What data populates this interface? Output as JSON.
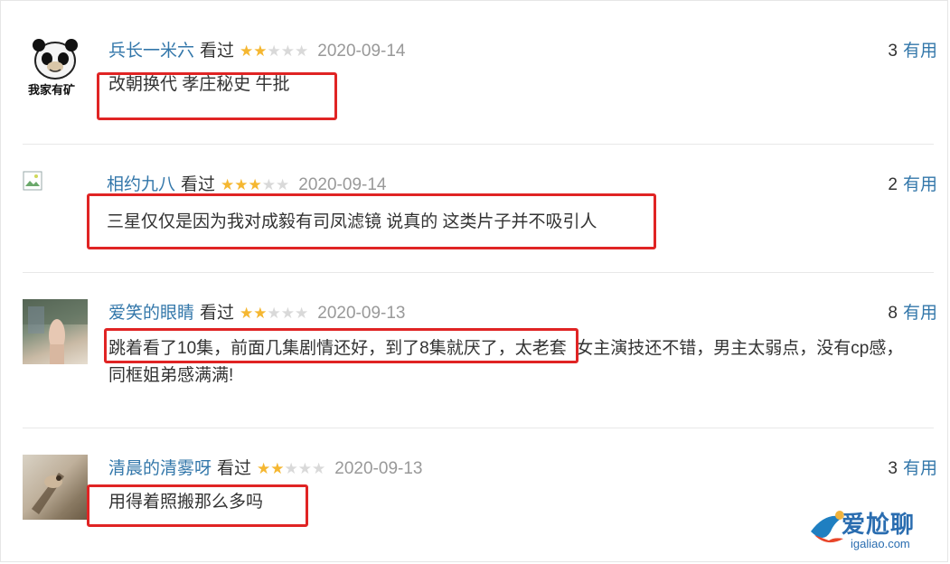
{
  "reviews": [
    {
      "user": "兵长一米六",
      "watched": "看过",
      "rating": 2,
      "date": "2020-09-14",
      "useful_count": "3",
      "useful_label": "有用",
      "comment": "改朝换代 孝庄秘史 牛批",
      "avatar_text": "我家有矿"
    },
    {
      "user": "相约九八",
      "watched": "看过",
      "rating": 3,
      "date": "2020-09-14",
      "useful_count": "2",
      "useful_label": "有用",
      "comment": "三星仅仅是因为我对成毅有司凤滤镜 说真的 这类片子并不吸引人"
    },
    {
      "user": "爱笑的眼睛",
      "watched": "看过",
      "rating": 2,
      "date": "2020-09-13",
      "useful_count": "8",
      "useful_label": "有用",
      "comment_line1": "跳着看了10集，前面几集剧情还好，到了8集就厌了，太老套  女主演技还不错，男主太弱点，没有cp感，",
      "comment_line2": "同框姐弟感满满!"
    },
    {
      "user": "清晨的清雾呀",
      "watched": "看过",
      "rating": 2,
      "date": "2020-09-13",
      "useful_count": "3",
      "useful_label": "有用",
      "comment": "用得着照搬那么多吗"
    }
  ],
  "watermark": {
    "text": "爱尬聊",
    "sub": "igaliao.com",
    "brand_color": "#2a6db0"
  },
  "colors": {
    "username": "#3377aa",
    "star_on": "#f5b731",
    "star_off": "#d9d9d9",
    "highlight": "#e02424"
  }
}
